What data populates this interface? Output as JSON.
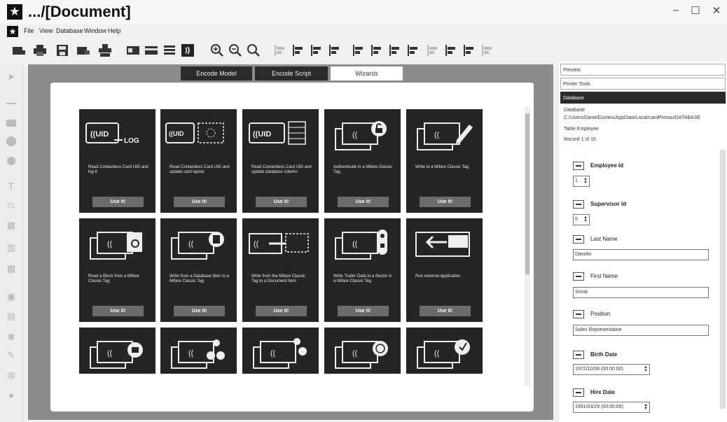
{
  "window": {
    "title": ".../[Document]",
    "controls": {
      "minimize": "–",
      "maximize": "☐",
      "close": "✕"
    }
  },
  "menu": {
    "items": [
      "File",
      "View",
      "Database",
      "Window",
      "Help"
    ]
  },
  "toolbar": {
    "icons": [
      "new-card-icon",
      "print-icon",
      "save-icon",
      "encode-icon",
      "printer-tools-icon",
      "card-front-icon",
      "card-back-icon",
      "list-icon",
      "contactless-icon",
      "zoom-in-icon",
      "zoom-out-icon",
      "zoom-fit-icon",
      "align-left-icon",
      "align-center-icon",
      "align-right-icon",
      "align-top-icon",
      "align-middle-icon",
      "align-bottom-icon",
      "distribute-h-icon",
      "distribute-v-icon",
      "same-width-icon",
      "same-height-icon",
      "same-size-icon",
      "bring-front-icon"
    ]
  },
  "tools": {
    "icons": [
      "pointer-icon",
      "line-icon",
      "rectangle-icon",
      "ellipse-icon",
      "circle-icon",
      "text-icon",
      "counter-icon",
      "date-icon",
      "barcode-icon",
      "qrcode-icon",
      "image-icon",
      "picture-icon",
      "camera-icon",
      "signature-icon",
      "fingerprint-icon",
      "shape-icon"
    ]
  },
  "tabs": {
    "encode_model": "Encode Model",
    "encode_script": "Encode Script",
    "wizards": "Wizards"
  },
  "wizards": {
    "use_label": "Use it!",
    "cards": [
      {
        "id": "uid-log",
        "desc": "Read Contactless Card UID and log it"
      },
      {
        "id": "uid-layout",
        "desc": "Read Contactless Card UID and update card layout"
      },
      {
        "id": "uid-db",
        "desc": "Read Contactless Card UID and update database column"
      },
      {
        "id": "auth-mifare",
        "desc": "Authenticate in a Mifare Classic Tag"
      },
      {
        "id": "write-mifare",
        "desc": "Write to a Mifare Classic Tag"
      },
      {
        "id": "read-block",
        "desc": "Read a Block from a Mifare Classic Tag"
      },
      {
        "id": "write-db-item",
        "desc": "Write from a Database Item to a Mifare Classic Tag"
      },
      {
        "id": "write-doc-item",
        "desc": "Write from the Mifare Classic Tag to a Document Item"
      },
      {
        "id": "write-trailer",
        "desc": "Write Trailer Data to a Sector in a Mifare Classic Tag"
      },
      {
        "id": "run-external",
        "desc": "Run external application"
      },
      {
        "id": "card-11",
        "desc": ""
      },
      {
        "id": "card-12",
        "desc": ""
      },
      {
        "id": "card-13",
        "desc": ""
      },
      {
        "id": "card-14",
        "desc": ""
      },
      {
        "id": "card-15",
        "desc": ""
      }
    ]
  },
  "right_panel": {
    "tabs": [
      "Preview",
      "Printer Tools",
      "Database"
    ],
    "active_tab": "Database",
    "database_label": "Database",
    "database_path": "C:/Users/DanielGomes/AppData/Local/cardPresso/DATABASE",
    "table_label": "Table Employee",
    "record_label": "Record 1 of 15",
    "fields": {
      "employee_id": {
        "label": "Employee Id",
        "value": "1"
      },
      "supervisor_id": {
        "label": "Supervisor Id",
        "value": "5"
      },
      "last_name": {
        "label": "Last Name",
        "value": "Davolio"
      },
      "first_name": {
        "label": "First Name",
        "value": "Sonia"
      },
      "position": {
        "label": "Position",
        "value": "Sales Representative"
      },
      "birth_date": {
        "label": "Birth Date",
        "value": "1972/12/08 (00:00:00)"
      },
      "hire_date": {
        "label": "Hire Date",
        "value": "1991/03/29 (00:00:00)"
      }
    }
  }
}
